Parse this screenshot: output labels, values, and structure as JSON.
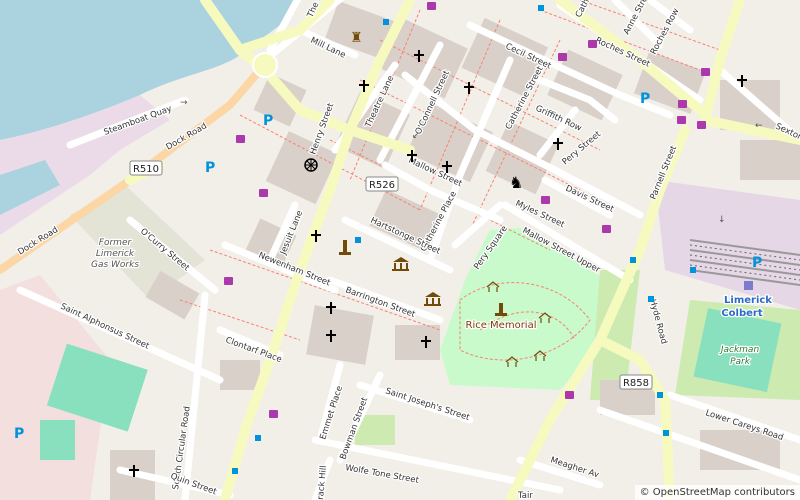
{
  "map": {
    "streets": [
      {
        "id": "the-bishop",
        "text": "The Bis"
      },
      {
        "id": "mill-lane",
        "text": "Mill Lane"
      },
      {
        "id": "steamboat-quay",
        "text": "Steamboat Quay"
      },
      {
        "id": "dock-road-upper",
        "text": "Dock Road"
      },
      {
        "id": "dock-road-lower",
        "text": "Dock Road"
      },
      {
        "id": "henry-street",
        "text": "Henry Street"
      },
      {
        "id": "theatre-lane",
        "text": "Theatre Lane"
      },
      {
        "id": "oconnell-street",
        "text": "O'Connell Street"
      },
      {
        "id": "cecil-street",
        "text": "Cecil Street"
      },
      {
        "id": "catherine-street",
        "text": "Catherine Street"
      },
      {
        "id": "griffith-row",
        "text": "Griffith Row"
      },
      {
        "id": "pery-street",
        "text": "Pery Street"
      },
      {
        "id": "mallow-street",
        "text": "Mallow Street"
      },
      {
        "id": "catherine-place",
        "text": "Catherine Place"
      },
      {
        "id": "myles-street",
        "text": "Myles Street"
      },
      {
        "id": "davis-street",
        "text": "Davis Street"
      },
      {
        "id": "mallow-street-upper",
        "text": "Mallow Street Upper"
      },
      {
        "id": "pery-square",
        "text": "Pery Square"
      },
      {
        "id": "hartstonge-street",
        "text": "Hartstonge Street"
      },
      {
        "id": "jesuit-lane",
        "text": "Jesuit Lane"
      },
      {
        "id": "newenham-street",
        "text": "Newenham Street"
      },
      {
        "id": "barrington-street",
        "text": "Barrington Street"
      },
      {
        "id": "ocurry-street",
        "text": "O'Curry Street"
      },
      {
        "id": "saint-alphonsus-street",
        "text": "Saint Alphonsus Street"
      },
      {
        "id": "clontarf-place",
        "text": "Clontarf Place"
      },
      {
        "id": "south-circular-road",
        "text": "South Circular Road"
      },
      {
        "id": "quin-street",
        "text": "Quin Street"
      },
      {
        "id": "emmet-place",
        "text": "Emmet Place"
      },
      {
        "id": "bowman-street",
        "text": "Bowman Street"
      },
      {
        "id": "saint-josephs-street",
        "text": "Saint Joseph's Street"
      },
      {
        "id": "wolfe-tone-street",
        "text": "Wolfe Tone Street"
      },
      {
        "id": "crack-hill",
        "text": "rack Hill"
      },
      {
        "id": "meagher-avenue",
        "text": "Meagher Av"
      },
      {
        "id": "lower-careys-road",
        "text": "Lower Careys Road"
      },
      {
        "id": "hyde-road",
        "text": "Hyde Road"
      },
      {
        "id": "parnell-street",
        "text": "Parnell Street"
      },
      {
        "id": "roches-street",
        "text": "Roches Street"
      },
      {
        "id": "anne-street",
        "text": "Anne Street"
      },
      {
        "id": "roches-row",
        "text": "Roches Row"
      },
      {
        "id": "catherine-street-top",
        "text": "Catherine"
      },
      {
        "id": "sexton",
        "text": "Sexton"
      },
      {
        "id": "tair",
        "text": "Tair"
      }
    ],
    "road_refs": [
      {
        "id": "r510",
        "text": "R510"
      },
      {
        "id": "r526",
        "text": "R526"
      },
      {
        "id": "r858",
        "text": "R858"
      }
    ],
    "places": [
      {
        "id": "former-gas-works",
        "lines": [
          "Former",
          "Limerick",
          "Gas Works"
        ]
      },
      {
        "id": "rice-memorial",
        "text": "Rice Memorial"
      },
      {
        "id": "limerick-colbert",
        "lines": [
          "Limerick",
          "Colbert"
        ]
      },
      {
        "id": "jackman-park",
        "lines": [
          "Jackman",
          "Park"
        ]
      }
    ],
    "parking_symbol": "P",
    "colors": {
      "background": "#f2efe9",
      "water": "#aad3df",
      "park": "#c8facc",
      "grass": "#cdebb0",
      "pitch": "#88e0be",
      "industrial": "#ebdbe8",
      "railway_land": "#e6d7e6",
      "building": "#d9d0c9",
      "major_road": "#f7fabf",
      "secondary_road": "#fcd6a4",
      "pedestrian": "#fa8072",
      "poi_brown": "#734a08",
      "shop": "#ac39ac",
      "transit": "#0092da"
    }
  },
  "attribution": {
    "prefix": "© ",
    "link": "OpenStreetMap",
    "suffix": " contributors"
  }
}
